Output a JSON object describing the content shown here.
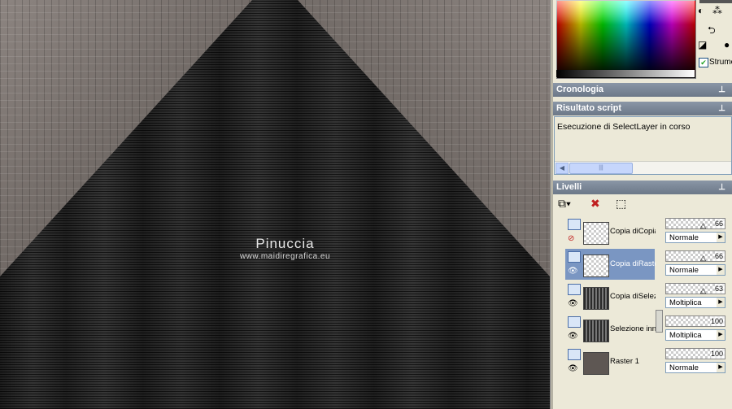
{
  "canvas": {
    "watermark_name": "Pinuccia",
    "watermark_url": "www.maidiregrafica.eu"
  },
  "materials": {
    "checkbox_label": "Strume"
  },
  "panels": {
    "history_title": "Cronologia",
    "script_title": "Risultato script",
    "script_output": "Esecuzione di SelectLayer in corso",
    "layers_title": "Livelli"
  },
  "layers": [
    {
      "name": "Copia diCopia",
      "opacity": "66",
      "blend": "Normale",
      "thumb": "checker-tri",
      "visible": false,
      "selected": false
    },
    {
      "name": "Copia diRaster",
      "opacity": "66",
      "blend": "Normale",
      "thumb": "checker-tri",
      "visible": true,
      "selected": true
    },
    {
      "name": "Copia diSelez",
      "opacity": "63",
      "blend": "Moltiplica",
      "thumb": "stripe-tri",
      "visible": true,
      "selected": false
    },
    {
      "name": "Selezione inn",
      "opacity": "100",
      "blend": "Moltiplica",
      "thumb": "stripe-tri",
      "visible": true,
      "selected": false
    },
    {
      "name": "Raster 1",
      "opacity": "100",
      "blend": "Normale",
      "thumb": "raster",
      "visible": true,
      "selected": false
    }
  ],
  "icons": {
    "pin": "pin-icon",
    "eye": "eye-icon",
    "hidden": "hidden-icon"
  }
}
